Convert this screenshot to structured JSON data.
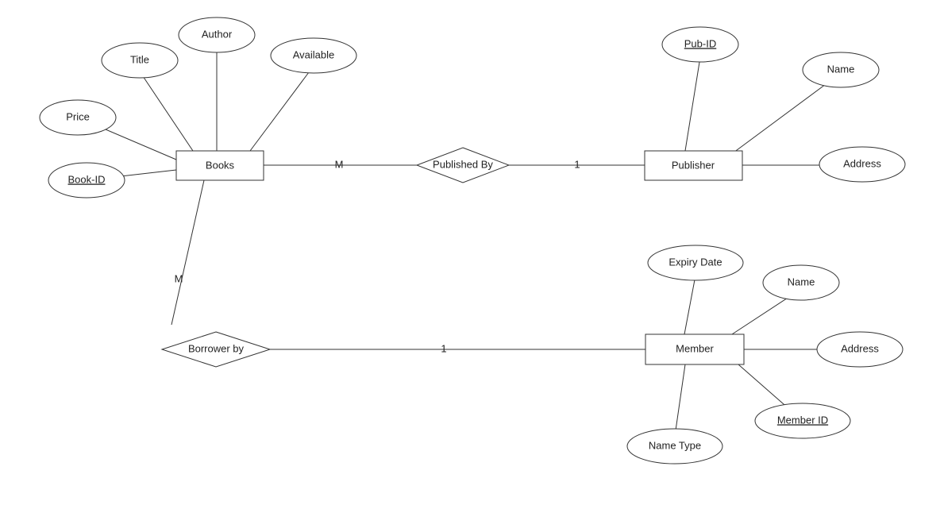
{
  "entities": {
    "books": {
      "label": "Books"
    },
    "publisher": {
      "label": "Publisher"
    },
    "member": {
      "label": "Member"
    }
  },
  "relationships": {
    "published_by": {
      "label": "Published By",
      "left_card": "M",
      "right_card": "1"
    },
    "borrower_by": {
      "label": "Borrower by",
      "left_card": "M",
      "right_card": "1"
    }
  },
  "attributes": {
    "books": {
      "book_id": {
        "label": "Book-ID",
        "key": true
      },
      "price": {
        "label": "Price"
      },
      "title": {
        "label": "Title"
      },
      "author": {
        "label": "Author"
      },
      "available": {
        "label": "Available"
      }
    },
    "publisher": {
      "pub_id": {
        "label": "Pub-ID",
        "key": true
      },
      "name": {
        "label": "Name"
      },
      "address": {
        "label": "Address"
      }
    },
    "member": {
      "expiry_date": {
        "label": "Expiry Date"
      },
      "name": {
        "label": "Name"
      },
      "address": {
        "label": "Address"
      },
      "member_id": {
        "label": "Member ID",
        "key": true
      },
      "name_type": {
        "label": "Name Type"
      }
    }
  }
}
